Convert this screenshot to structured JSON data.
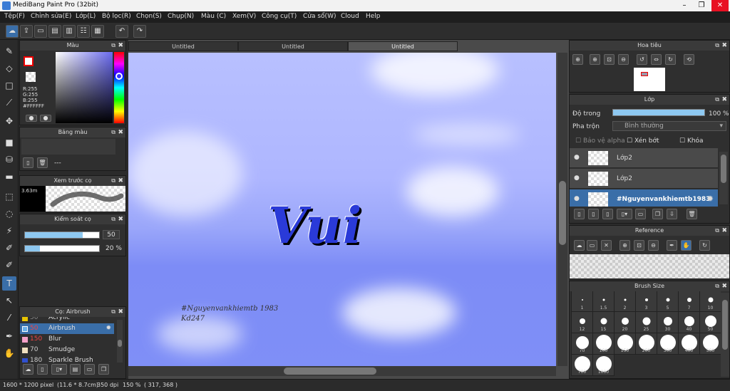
{
  "window": {
    "title": "MediBang Paint Pro (32bit)",
    "min": "–",
    "max": "❐",
    "close": "✕"
  },
  "menu": [
    "Tệp(F)",
    "Chỉnh sửa(E)",
    "Lớp(L)",
    "Bộ lọc(R)",
    "Chọn(S)",
    "Chụp(N)",
    "Màu (C)",
    "Xem(V)",
    "Công cụ(T)",
    "Cửa sổ(W)",
    "Cloud",
    "Help"
  ],
  "tabs": [
    "Untitled",
    "Untitled",
    "Untitled"
  ],
  "color_panel": {
    "title": "Màu",
    "r": "R:255",
    "g": "G:255",
    "b": "B:255",
    "hex": "#FFFFFF"
  },
  "palette_panel": {
    "title": "Bảng màu",
    "placeholder": "---"
  },
  "preview_panel": {
    "title": "Xem trước cọ",
    "size": "3.63m"
  },
  "control_panel": {
    "title": "Kiểm soát cọ",
    "size_value": "50",
    "opacity_value": "20 %",
    "size_pct": 0.78,
    "opacity_pct": 0.2
  },
  "brush_panel": {
    "title": "Cọ: Airbrush",
    "items": [
      {
        "size": "50",
        "name": "Acrylic",
        "color": "#e8c400"
      },
      {
        "size": "50",
        "name": "Airbrush",
        "color": "#6ab0e8"
      },
      {
        "size": "150",
        "name": "Blur",
        "color": "#f5a0c8"
      },
      {
        "size": "70",
        "name": "Smudge",
        "color": "#f0e0c0"
      },
      {
        "size": "180",
        "name": "Sparkle Brush",
        "color": "#3050d0"
      }
    ]
  },
  "canvas": {
    "text_main": "Vui",
    "text_tag": "#Nguyenvankhiemtb 1983",
    "text_sig": "Kd247",
    "bg_top": "#b8c0ff",
    "bg_bottom": "#7d8cf6"
  },
  "navigator": {
    "title": "Hoa tiêu"
  },
  "layer_panel": {
    "title": "Lớp",
    "opacity_label": "Độ trong",
    "opacity_value": "100 %",
    "blend_label": "Pha trộn",
    "blend_value": "Bình thường",
    "protect_alpha": "Bảo vệ alpha",
    "clipping": "Xén bớt",
    "lock": "Khóa",
    "layers": [
      "Lớp2",
      "Lớp2",
      "#Nguyenvankhiemtb1983"
    ]
  },
  "reference_panel": {
    "title": "Reference"
  },
  "brush_size_panel": {
    "title": "Brush Size",
    "sizes": [
      "1",
      "1.5",
      "2",
      "3",
      "5",
      "7",
      "10",
      "12",
      "15",
      "20",
      "25",
      "30",
      "40",
      "50",
      "70",
      "100",
      "150",
      "200",
      "300",
      "400",
      "500",
      "700",
      "1000"
    ]
  },
  "status": {
    "dimensions": "1600 * 1200 pixel",
    "physical": "(11.6 * 8.7cm)",
    "dpi": "350 dpi",
    "zoom": "150 %",
    "coords": "( 317, 368 )"
  }
}
